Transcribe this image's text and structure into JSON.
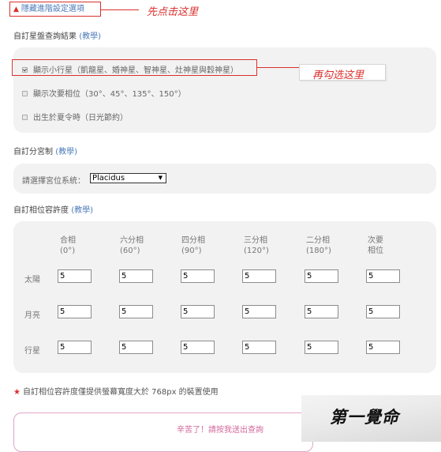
{
  "toggle": {
    "icon": "triangle-up-icon",
    "label": "隱藏進階設定選項"
  },
  "annotations": {
    "first": "先点击这里",
    "second": "再勾选这里"
  },
  "sections": {
    "result": {
      "title": "自訂星盤查詢結果",
      "link": "(教學)"
    },
    "house": {
      "title": "自訂分宮制",
      "link": "(教學)"
    },
    "orb": {
      "title": "自訂相位容許度",
      "link": "(教學)"
    }
  },
  "options": [
    {
      "label": "顯示小行星（凱龍星、婚神星、智神星、灶神星與穀神星）",
      "checked": true
    },
    {
      "label": "顯示次要相位（30°、45°、135°、150°）",
      "checked": false
    },
    {
      "label": "出生於夏令時（日光節約）",
      "checked": false
    }
  ],
  "house_system": {
    "label": "請選擇宮位系統：",
    "selected": "Placidus"
  },
  "orb_table": {
    "columns": [
      {
        "line1": "合相",
        "line2": "(0°)"
      },
      {
        "line1": "六分相",
        "line2": "(60°)"
      },
      {
        "line1": "四分相",
        "line2": "(90°)"
      },
      {
        "line1": "三分相",
        "line2": "(120°)"
      },
      {
        "line1": "二分相",
        "line2": "(180°)"
      },
      {
        "line1": "次要",
        "line2": "相位"
      }
    ],
    "rows": [
      {
        "label": "太陽",
        "values": [
          "5",
          "5",
          "5",
          "5",
          "5",
          "5"
        ]
      },
      {
        "label": "月亮",
        "values": [
          "5",
          "5",
          "5",
          "5",
          "5",
          "5"
        ]
      },
      {
        "label": "行星",
        "values": [
          "5",
          "5",
          "5",
          "5",
          "5",
          "5"
        ]
      }
    ]
  },
  "note": {
    "icon": "star-icon",
    "text": "自訂相位容許度僅提供螢幕寬度大於 768px 的裝置使用"
  },
  "submit": {
    "label": "辛苦了！請按我送出查詢"
  },
  "watermark": {
    "text": "第一覺命"
  },
  "colors": {
    "accent_red": "#d9302c",
    "link_blue": "#4a78b8",
    "panel_bg": "#f2f2f2",
    "submit_pink": "#d26a9c"
  }
}
